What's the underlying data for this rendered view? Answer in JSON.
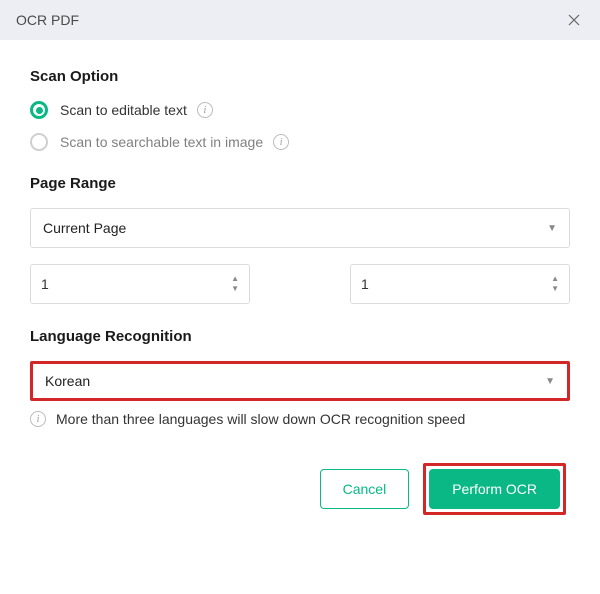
{
  "titlebar": {
    "title": "OCR PDF"
  },
  "scan_option": {
    "heading": "Scan Option",
    "option1_label": "Scan to editable text",
    "option2_label": "Scan to searchable text in image"
  },
  "page_range": {
    "heading": "Page Range",
    "selected": "Current Page",
    "from_value": "1",
    "to_value": "1"
  },
  "language": {
    "heading": "Language Recognition",
    "selected": "Korean",
    "note": "More than three languages will slow down OCR recognition speed"
  },
  "buttons": {
    "cancel": "Cancel",
    "primary": "Perform OCR"
  }
}
